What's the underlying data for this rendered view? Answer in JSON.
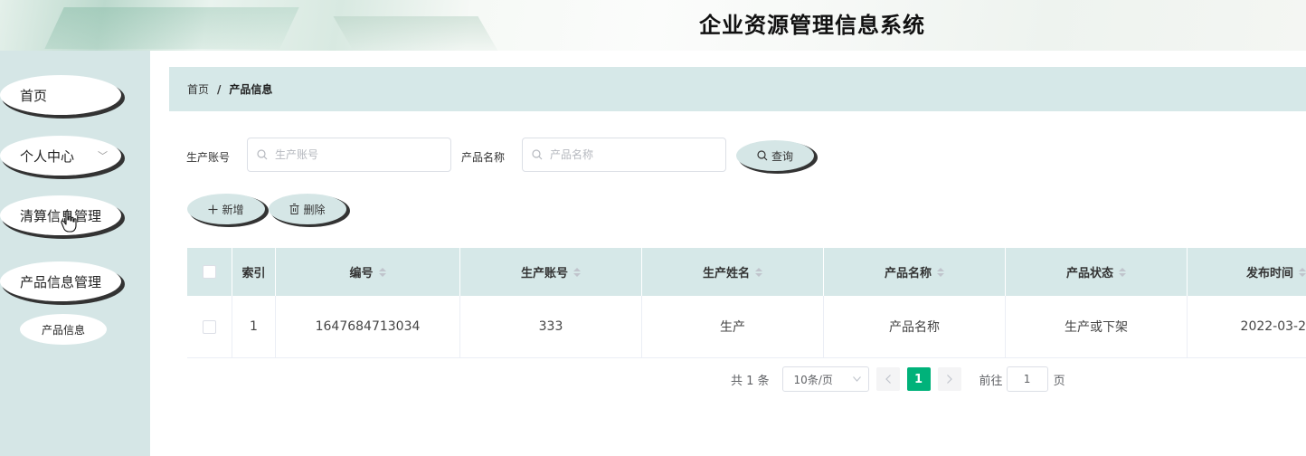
{
  "app": {
    "title": "企业资源管理信息系统"
  },
  "sidebar": {
    "items": [
      {
        "label": "首页"
      },
      {
        "label": "个人中心",
        "chevron": "﹀"
      },
      {
        "label": "清算信息管理"
      },
      {
        "label": "产品信息管理"
      }
    ],
    "sub_items": [
      {
        "label": "产品信息"
      }
    ]
  },
  "breadcrumb": {
    "home": "首页",
    "separator": "/",
    "current": "产品信息"
  },
  "search": {
    "account_label": "生产账号",
    "account_placeholder": "生产账号",
    "name_label": "产品名称",
    "name_placeholder": "产品名称",
    "query_button": "查询"
  },
  "actions": {
    "add": "新增",
    "delete": "删除"
  },
  "table": {
    "columns": [
      "索引",
      "编号",
      "生产账号",
      "生产姓名",
      "产品名称",
      "产品状态",
      "发布时间"
    ],
    "rows": [
      {
        "index": "1",
        "code": "1647684713034",
        "account": "333",
        "producer": "生产",
        "product_name": "产品名称",
        "status": "生产或下架",
        "publish_time": "2022-03-2"
      }
    ]
  },
  "pagination": {
    "total": "共 1 条",
    "page_size": "10条/页",
    "current_page": "1",
    "goto_label": "前往",
    "goto_value": "1",
    "page_suffix": "页"
  },
  "colors": {
    "accent": "#00b27a",
    "panel": "#d6e8e8",
    "sidebar": "#d5e6e6"
  }
}
